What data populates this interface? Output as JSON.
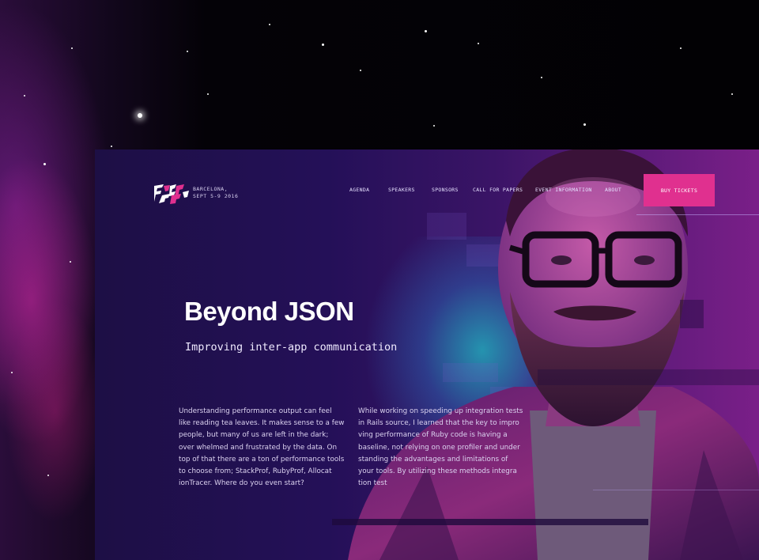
{
  "event": {
    "logo_alt": "Full Stack Fest",
    "city": "BARCELONA,",
    "dates": "SEPT 5-9 2016"
  },
  "nav": {
    "items": [
      {
        "label": "AGENDA"
      },
      {
        "label": "SPEAKERS"
      },
      {
        "label": "SPONSORS"
      },
      {
        "label": "CALL FOR PAPERS"
      },
      {
        "label": "EVENT INFORMATION"
      },
      {
        "label": "ABOUT"
      }
    ],
    "cta": "BUY TICKETS"
  },
  "hero": {
    "title": "Beyond JSON",
    "subtitle": "Improving inter-app communication"
  },
  "body": {
    "col1": "Understanding performance output can feel like reading tea leaves. It makes sense to a few people, but many of us are left in the dark; over whelmed and frustrated by the data. On top of that there are a ton of performance tools to choose from; StackProf, RubyProf, Allocat ionTracer. Where do you even start?",
    "col2": "While working on speeding up integration tests in Rails source, I learned that the key to impro ving performance of Ruby code is having a baseline, not relying on one profiler and under standing the advantages and limitations of your tools. By utilizing these methods integra tion test"
  },
  "colors": {
    "accent": "#e0308f",
    "panel": "#241058",
    "glow": "#1ebec8"
  }
}
